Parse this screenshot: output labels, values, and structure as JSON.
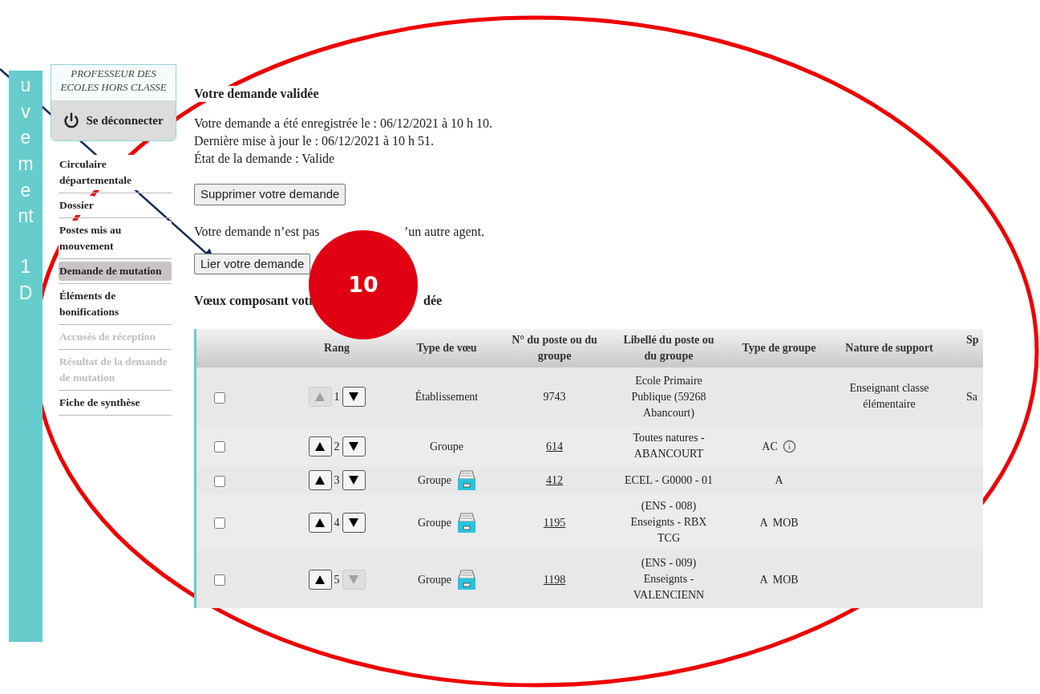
{
  "side_banner": {
    "lines": [
      "uvement",
      "1D"
    ]
  },
  "profile": {
    "grade_lines": [
      "PROFESSEUR DES",
      "ECOLES HORS CLASSE"
    ],
    "logout": "Se déconnecter"
  },
  "sidebar": {
    "items": [
      {
        "label": "Circulaire départementale",
        "selected": false,
        "disabled": false
      },
      {
        "label": "Dossier",
        "selected": false,
        "disabled": false
      },
      {
        "label": "Postes mis au mouvement",
        "selected": false,
        "disabled": false
      },
      {
        "label": "Demande de mutation",
        "selected": true,
        "disabled": false
      },
      {
        "label": "Éléments de bonifications",
        "selected": false,
        "disabled": false
      },
      {
        "label": "Accusés de réception",
        "selected": false,
        "disabled": true
      },
      {
        "label": "Résultat de la demande de mutation",
        "selected": false,
        "disabled": true
      },
      {
        "label": "Fiche de synthèse",
        "selected": false,
        "disabled": false
      }
    ]
  },
  "main": {
    "title": "Votre demande validée",
    "info_lines": [
      "Votre demande a été enregistrée le : 06/12/2021 à 10 h 10.",
      "Dernière mise à jour le : 06/12/2021 à 10 h 51.",
      "État de la demande : Valide"
    ],
    "delete_button": "Supprimer votre demande",
    "link_status": [
      "Votre demande n’est pas",
      "’un autre agent."
    ],
    "link_button": "Lier votre demande",
    "wishes_title": [
      "Vœux composant votr",
      "dée"
    ]
  },
  "table": {
    "columns": [
      "",
      "Rang",
      "Type de vœu",
      "N° du poste ou du groupe",
      "Libellé du poste ou du groupe",
      "Type de groupe",
      "Nature de support",
      "Sp"
    ],
    "rows": [
      {
        "checked": false,
        "up_disabled": true,
        "down_disabled": false,
        "rank": "1",
        "type": "Établissement",
        "archive_icon": false,
        "number": "9743",
        "number_link": false,
        "label": "Ecole Primaire Publique (59268 Abancourt)",
        "group_type": "",
        "info_icon": false,
        "nature": "Enseignant classe élémentaire",
        "column_8": "Sa"
      },
      {
        "checked": false,
        "up_disabled": false,
        "down_disabled": false,
        "rank": "2",
        "type": "Groupe",
        "archive_icon": false,
        "number": "614",
        "number_link": true,
        "label": "Toutes natures - ABANCOURT",
        "group_type": "AC",
        "info_icon": true,
        "nature": "",
        "column_8": ""
      },
      {
        "checked": false,
        "up_disabled": false,
        "down_disabled": false,
        "rank": "3",
        "type": "Groupe",
        "archive_icon": true,
        "number": "412",
        "number_link": true,
        "label": "ECEL - G0000 - 01",
        "group_type": "A",
        "info_icon": false,
        "nature": "",
        "column_8": ""
      },
      {
        "checked": false,
        "up_disabled": false,
        "down_disabled": false,
        "rank": "4",
        "type": "Groupe",
        "archive_icon": true,
        "number": "1195",
        "number_link": true,
        "label": "(ENS - 008) Enseignts - RBX TCG",
        "group_type": "A  MOB",
        "info_icon": false,
        "nature": "",
        "column_8": ""
      },
      {
        "checked": false,
        "up_disabled": false,
        "down_disabled": true,
        "rank": "5",
        "type": "Groupe",
        "archive_icon": true,
        "number": "1198",
        "number_link": true,
        "label": "(ENS - 009) Enseignts - VALENCIENN",
        "group_type": "A  MOB",
        "info_icon": false,
        "nature": "",
        "column_8": ""
      }
    ]
  },
  "annotation": {
    "badge": "10"
  }
}
